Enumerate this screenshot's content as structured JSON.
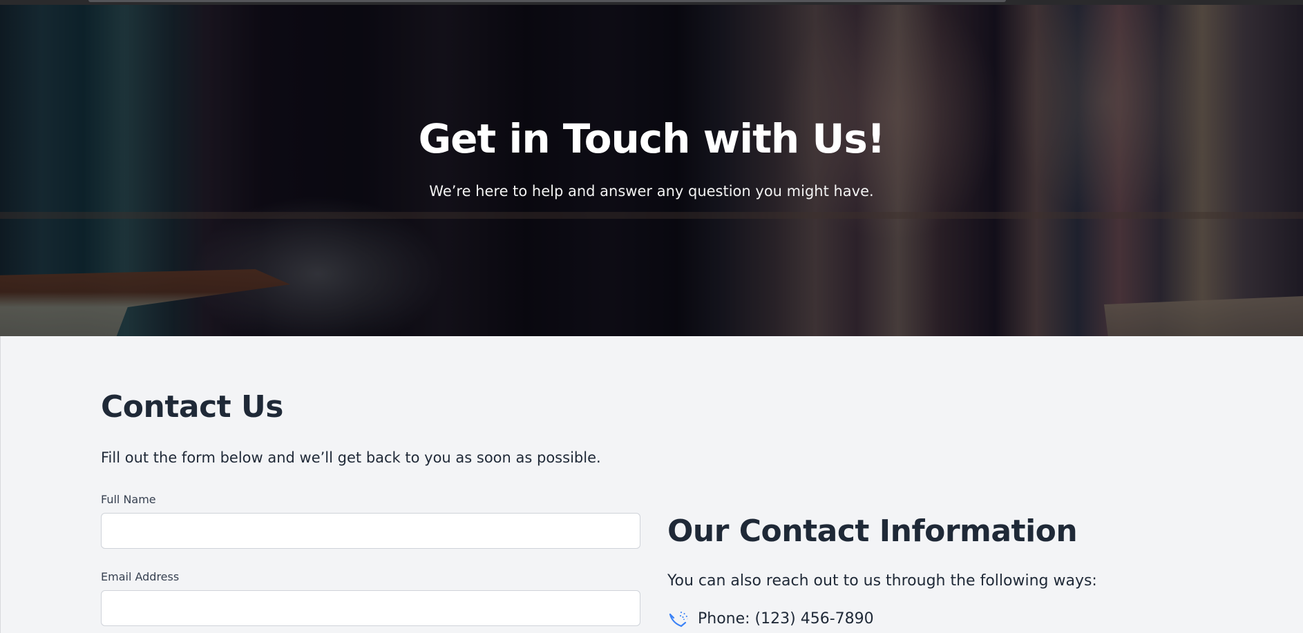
{
  "hero": {
    "title": "Get in Touch with Us!",
    "subtitle": "We’re here to help and answer any question you might have."
  },
  "contact": {
    "title": "Contact Us",
    "description": "Fill out the form below and we’ll get back to you as soon as possible.",
    "fields": [
      {
        "label": "Full Name",
        "value": "",
        "placeholder": ""
      },
      {
        "label": "Email Address",
        "value": "",
        "placeholder": ""
      }
    ]
  },
  "info": {
    "title": "Our Contact Information",
    "description": "You can also reach out to us through the following ways:",
    "items": [
      {
        "icon": "phone-icon",
        "text": "Phone: (123) 456-7890"
      }
    ]
  },
  "colors": {
    "heading": "#1f2937",
    "background": "#f3f4f6",
    "icon_accent": "#3b82f6"
  }
}
